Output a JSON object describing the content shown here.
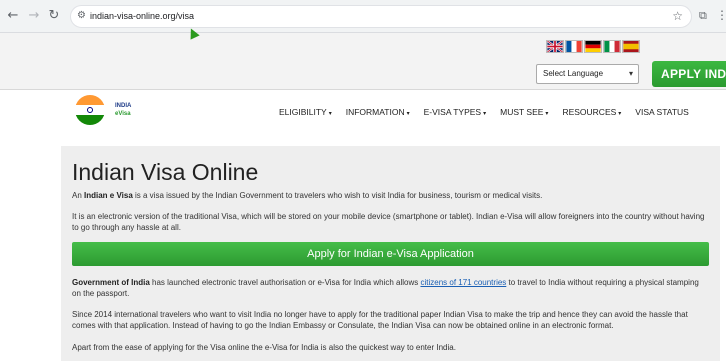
{
  "browser": {
    "back_icon": "←",
    "forward_icon": "→",
    "reload_icon": "↻",
    "site_info_icon": "⚙",
    "url": "indian-visa-online.org/visa",
    "bookmark_icon": "☆",
    "extensions_icon": "⧉",
    "menu_icon": "⋮"
  },
  "topbar": {
    "language_select": "Select Language",
    "caret": "▾",
    "apply_button": "APPLY INDIA"
  },
  "header": {
    "logo_line1": "INDIA",
    "logo_line2": "eVisa",
    "nav": [
      {
        "label": "ELIGIBILITY",
        "dd": "▾"
      },
      {
        "label": "INFORMATION",
        "dd": "▾"
      },
      {
        "label": "E-VISA TYPES",
        "dd": "▾"
      },
      {
        "label": "MUST SEE",
        "dd": "▾"
      },
      {
        "label": "RESOURCES",
        "dd": "▾"
      },
      {
        "label": "VISA STATUS",
        "dd": ""
      }
    ]
  },
  "content": {
    "title": "Indian Visa Online",
    "p1_a": "An ",
    "p1_b": "Indian e Visa",
    "p1_c": " is a visa issued by the Indian Government to travelers who wish to visit India for business, tourism or medical visits.",
    "p2": "It is an electronic version of the traditional Visa, which will be stored on your mobile device (smartphone or tablet). Indian e-Visa will allow foreigners into the country without having to go through any hassle at all.",
    "apply_main": "Apply for Indian e-Visa Application",
    "p3_a": "Government of India",
    "p3_b": " has launched electronic travel authorisation or e-Visa for India which allows ",
    "p3_link": "citizens of 171 countries",
    "p3_c": " to travel to India without requiring a physical stamping on the passport.",
    "p4": "Since 2014 international travelers who want to visit India no longer have to apply for the traditional paper Indian Visa to make the trip and hence they can avoid the hassle that comes with that application. Instead of having to go the Indian Embassy or Consulate, the Indian Visa can now be obtained online in an electronic format.",
    "p5": "Apart from the ease of applying for the Visa online the e-Visa for India is also the quickest way to enter India."
  },
  "colors": {
    "accent_green": "#2a9a2f",
    "link_blue": "#1a5fb4",
    "content_bg": "#eeeeee"
  }
}
